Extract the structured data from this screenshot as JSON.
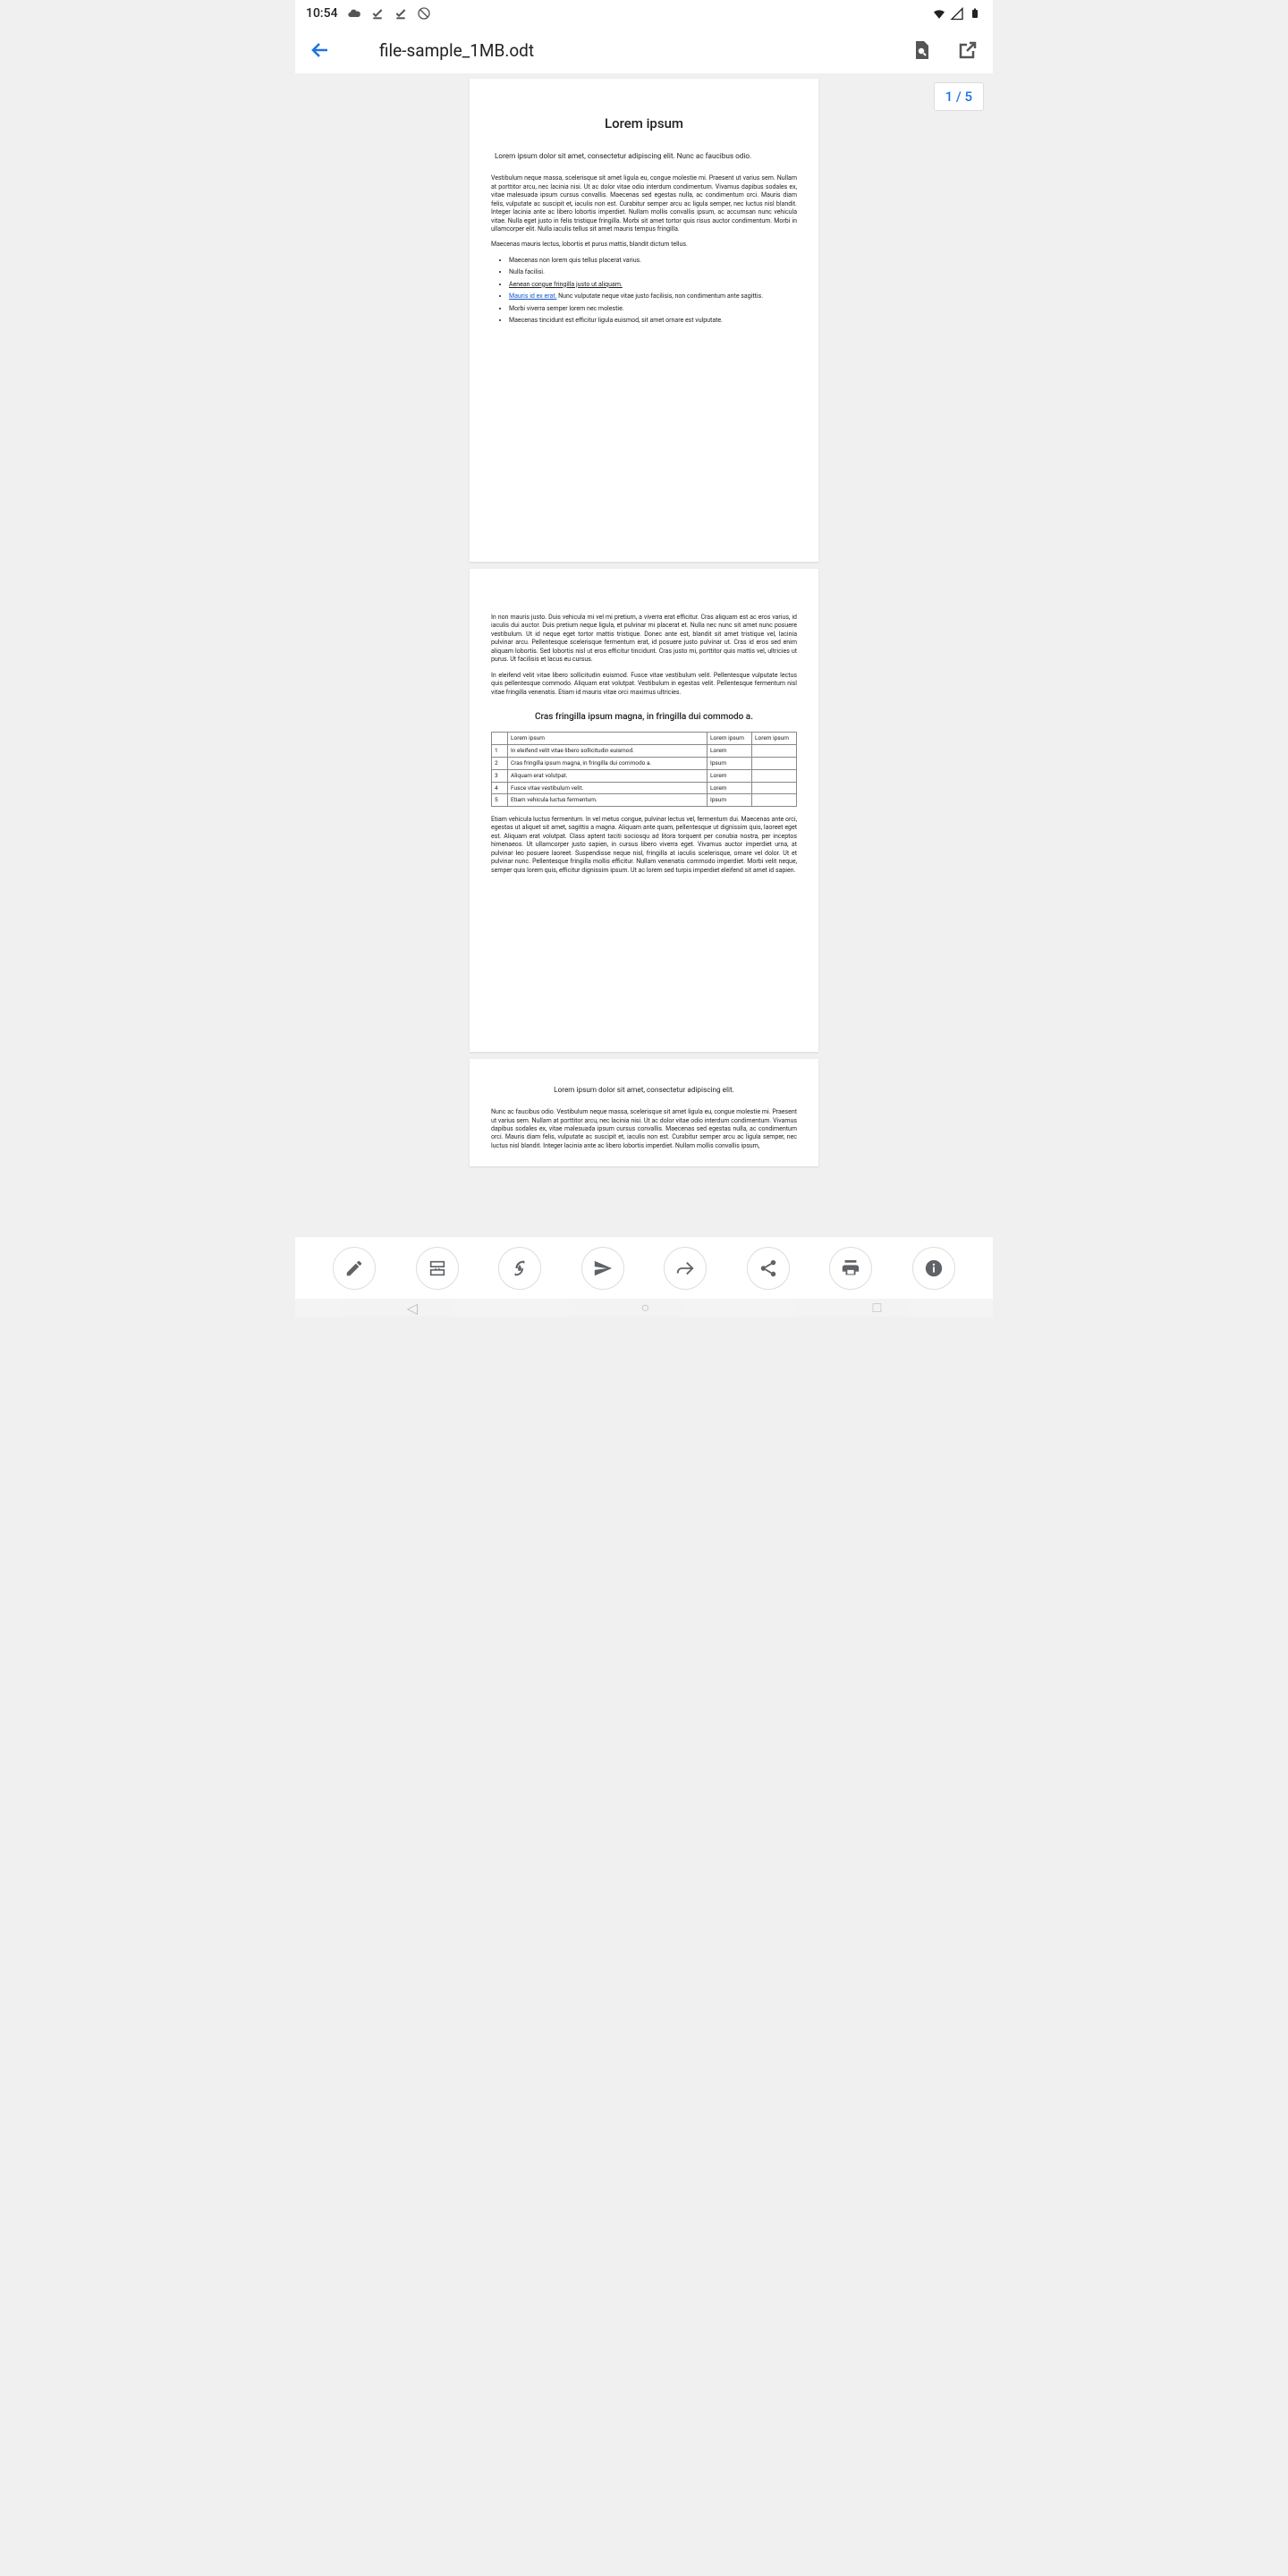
{
  "status": {
    "time": "10:54",
    "icons_left": [
      "cloud",
      "check1",
      "check2",
      "nosync"
    ],
    "icons_right": [
      "wifi",
      "signal",
      "battery"
    ]
  },
  "appbar": {
    "title": "file-sample_1MB.odt",
    "action_search": "search",
    "action_open": "open-external"
  },
  "page_indicator": "1 / 5",
  "page1": {
    "title": "Lorem ipsum",
    "intro": "Lorem ipsum dolor sit amet, consectetur adipiscing elit. Nunc ac faucibus odio.",
    "p1": "Vestibulum neque massa, scelerisque sit amet ligula eu, congue molestie mi. Praesent ut varius sem. Nullam at porttitor arcu, nec lacinia nisi. Ut ac dolor vitae odio interdum condimentum. Vivamus dapibus sodales ex, vitae malesuada ipsum cursus convallis. Maecenas sed egestas nulla, ac condimentum orci. Mauris diam felis, vulputate ac suscipit et, iaculis non est. Curabitur semper arcu ac ligula semper, nec luctus nisl blandit. Integer lacinia ante ac libero lobortis imperdiet. Nullam mollis convallis ipsum, ac accumsan nunc vehicula vitae. Nulla eget justo in felis tristique fringilla. Morbi sit amet tortor quis risus auctor condimentum. Morbi in ullamcorper elit. Nulla iaculis tellus sit amet mauris tempus fringilla.",
    "p2": "Maecenas mauris lectus, lobortis et purus mattis, blandit dictum tellus.",
    "li1": "Maecenas non lorem quis tellus placerat varius.",
    "li2": "Nulla facilisi.",
    "li3": "Aenean congue fringilla justo ut aliquam.",
    "li4a": "Mauris id ex erat.",
    "li4b": " Nunc vulputate neque vitae justo facilisis, non condimentum ante sagittis.",
    "li5": "Morbi viverra semper lorem nec molestie.",
    "li6": "Maecenas tincidunt est efficitur ligula euismod, sit amet ornare est vulputate."
  },
  "page2": {
    "p1": "In non mauris justo. Duis vehicula mi vel mi pretium, a viverra erat efficitur. Cras aliquam est ac eros varius, id iaculis dui auctor. Duis pretium neque ligula, et pulvinar mi placerat et. Nulla nec nunc sit amet nunc posuere vestibulum. Ut id neque eget tortor mattis tristique. Donec ante est, blandit sit amet tristique vel, lacinia pulvinar arcu. Pellentesque scelerisque fermentum erat, id posuere justo pulvinar ut. Cras id eros sed enim aliquam lobortis. Sed lobortis nisl ut eros efficitur tincidunt. Cras justo mi, porttitor quis mattis vel, ultricies ut purus. Ut facilisis et lacus eu cursus.",
    "p2": "In eleifend velit vitae libero sollicitudin euismod. Fusce vitae vestibulum velit. Pellentesque vulputate lectus quis pellentesque commodo. Aliquam erat volutpat. Vestibulum in egestas velit. Pellentesque fermentum nisl vitae fringilla venenatis. Etiam id mauris vitae orci maximus ultricies.",
    "h2": "Cras fringilla ipsum magna, in fringilla dui commodo a.",
    "th1": "Lorem ipsum",
    "th2": "Lorem ipsum",
    "th3": "Lorem ipsum",
    "r1n": "1",
    "r1a": "In eleifend velit vitae libero sollicitudin euismod.",
    "r1b": "Lorem",
    "r2n": "2",
    "r2a": "Cras fringilla ipsum magna, in fringilla dui commodo a.",
    "r2b": "Ipsum",
    "r3n": "3",
    "r3a": "Aliquam erat volutpat.",
    "r3b": "Lorem",
    "r4n": "4",
    "r4a": "Fusce vitae vestibulum velit.",
    "r4b": "Lorem",
    "r5n": "5",
    "r5a": "Etiam vehicula luctus fermentum.",
    "r5b": "Ipsum",
    "p3": "Etiam vehicula luctus fermentum. In vel metus congue, pulvinar lectus vel, fermentum dui. Maecenas ante orci, egestas ut aliquet sit amet, sagittis a magna. Aliquam ante quam, pellentesque ut dignissim quis, laoreet eget est. Aliquam erat volutpat. Class aptent taciti sociosqu ad litora torquent per conubia nostra, per inceptos himenaeos. Ut ullamcorper justo sapien, in cursus libero viverra eget. Vivamus auctor imperdiet urna, at pulvinar leo posuere laoreet. Suspendisse neque nisl, fringilla at iaculis scelerisque, ornare vel dolor. Ut et pulvinar nunc. Pellentesque fringilla mollis efficitur. Nullam venenatis commodo imperdiet. Morbi velit neque, semper quis lorem quis, efficitur dignissim ipsum. Ut ac lorem sed turpis imperdiet eleifend sit amet id sapien."
  },
  "page3": {
    "h": "Lorem ipsum dolor sit amet, consectetur adipiscing elit.",
    "p1": "Nunc ac faucibus odio. Vestibulum neque massa, scelerisque sit amet ligula eu, congue molestie mi. Praesent ut varius sem. Nullam at porttitor arcu, nec lacinia nisi. Ut ac dolor vitae odio interdum condimentum. Vivamus dapibus sodales ex, vitae malesuada ipsum cursus convallis. Maecenas sed egestas nulla, ac condimentum orci. Mauris diam felis, vulputate ac suscipit et, iaculis non est. Curabitur semper arcu ac ligula semper, nec luctus nisl blandit. Integer lacinia ante ac libero lobortis imperdiet. Nullam mollis convallis ipsum,"
  },
  "toolbar": {
    "edit": "edit",
    "layout": "read-mode",
    "rotation": "rotation-lock",
    "send": "send",
    "share_arrow": "forward",
    "share": "share",
    "print": "print",
    "info": "info"
  }
}
